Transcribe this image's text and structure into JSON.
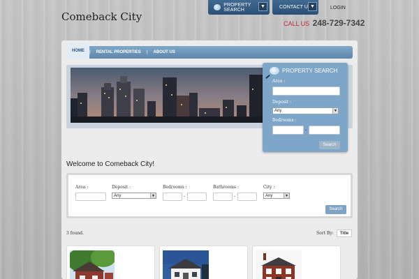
{
  "site": {
    "title": "Comeback City"
  },
  "top_nav": {
    "property_search": "PROPERTY SEARCH",
    "contact_us": "CONTACT US",
    "login": "LOGIN",
    "accent": "#2f5478"
  },
  "call": {
    "label": "CALL US",
    "number": "248-729-7342",
    "label_color": "#c4262a"
  },
  "main_nav": {
    "items": [
      "HOME",
      "RENTAL PROPERTIES",
      "ABOUT US"
    ],
    "active": "HOME"
  },
  "sidebar_search": {
    "title": "PROPERTY SEARCH",
    "area_label": "Area :",
    "deposit_label": "Deposit :",
    "deposit_value": "Any",
    "bedrooms_label": "Bedrooms :",
    "range_sep": "-",
    "button": "Search"
  },
  "welcome": {
    "heading": "Welcome to Comeback City!"
  },
  "filters": {
    "area_label": "Area :",
    "deposit_label": "Deposit :",
    "deposit_value": "Any",
    "bedrooms_label": "Bedrooms :",
    "bathrooms_label": "Bathrooms :",
    "city_label": "City :",
    "city_value": "Any",
    "range_sep": "-",
    "button": "Search"
  },
  "results": {
    "count_text": "3 found.",
    "sort_label": "Sort By:",
    "sort_value": "Title"
  },
  "listings": [
    {
      "photo": "house-red-brick-with-tree"
    },
    {
      "photo": "house-white-colonial-blue-sky"
    },
    {
      "photo": "house-red-brick-white-trim"
    }
  ]
}
